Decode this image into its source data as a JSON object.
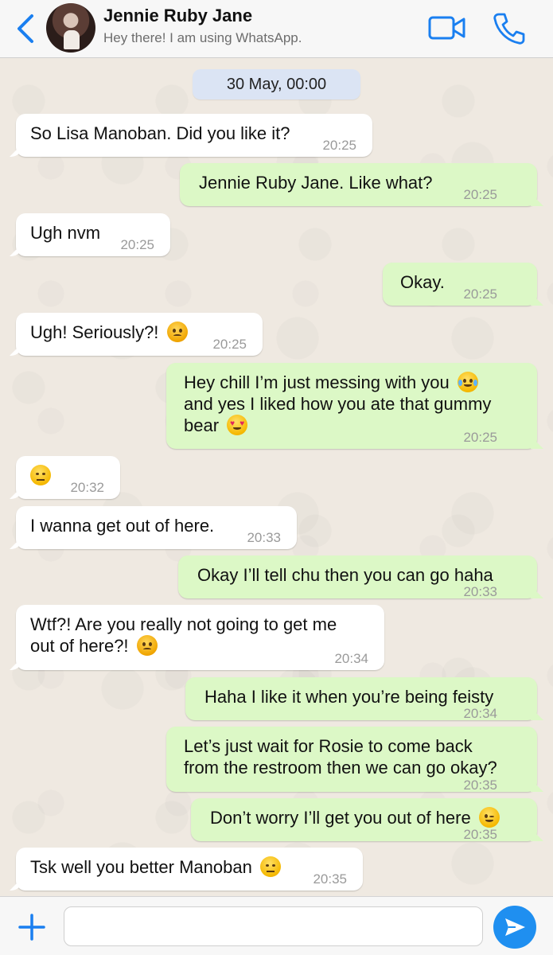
{
  "header": {
    "contact_name": "Jennie Ruby Jane",
    "contact_status": "Hey there! I am using WhatsApp.",
    "accent_color": "#1a7ff0"
  },
  "chat": {
    "date_label": "30 May, 00:00",
    "messages": [
      {
        "dir": "in",
        "text": "So Lisa Manoban. Did you like it?",
        "time": "20:25"
      },
      {
        "dir": "out",
        "text": "Jennie Ruby Jane. Like what?",
        "time": "20:25"
      },
      {
        "dir": "in",
        "text": "Ugh nvm",
        "time": "20:25"
      },
      {
        "dir": "out",
        "text": "Okay.",
        "time": "20:25"
      },
      {
        "dir": "in",
        "text": "Ugh! Seriously?!",
        "emoji": "angry-face-emoji",
        "time": "20:25"
      },
      {
        "dir": "out",
        "lines": [
          "Hey chill I’m just messing with you",
          "and yes I liked how you ate that gummy",
          "bear"
        ],
        "emoji_line1": "tears-of-joy-emoji",
        "emoji_line3": "heart-eyes-emoji",
        "time": "20:25"
      },
      {
        "dir": "in",
        "text": "",
        "emoji": "unamused-face-emoji",
        "time": "20:32"
      },
      {
        "dir": "in",
        "text": "I wanna get out of here.",
        "time": "20:33"
      },
      {
        "dir": "out",
        "text": "Okay I’ll tell chu then you can go haha",
        "time": "20:33"
      },
      {
        "dir": "in",
        "lines": [
          "Wtf?! Are you really not going to get me",
          "out of here?!"
        ],
        "emoji_line2": "angry-face-emoji",
        "time": "20:34"
      },
      {
        "dir": "out",
        "text": "Haha I like it when you’re being feisty",
        "time": "20:34"
      },
      {
        "dir": "out",
        "lines": [
          "Let’s just wait for Rosie to come back",
          "from the restroom then we can go okay?"
        ],
        "time": "20:35"
      },
      {
        "dir": "out",
        "text": "Don’t worry I’ll get you out of here",
        "emoji": "winking-face-emoji",
        "time": "20:35"
      },
      {
        "dir": "in",
        "text": "Tsk well you better Manoban",
        "emoji": "unamused-face-emoji",
        "time": "20:35"
      }
    ]
  },
  "input_bar": {
    "placeholder": "",
    "send_color": "#1f8ff0"
  },
  "icons": [
    "back-chevron-icon",
    "video-call-icon",
    "phone-icon",
    "plus-icon",
    "send-icon"
  ]
}
